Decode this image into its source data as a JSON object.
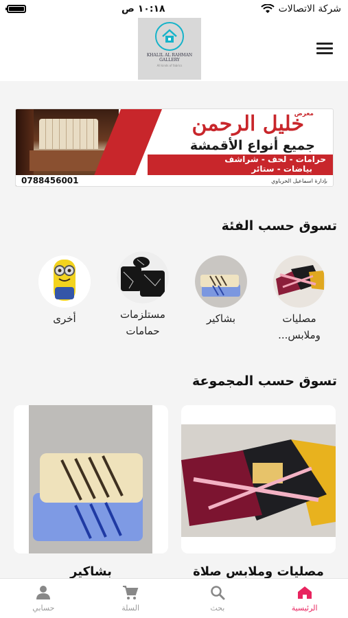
{
  "status": {
    "carrier": "شركة الاتصالات",
    "time": "١٠:١٨ ص"
  },
  "header": {
    "logo_name": "KHALIL AL RAHMAN GALLERY",
    "logo_tag": "All kinds of fabrics"
  },
  "banner": {
    "brand_small": "معرض",
    "brand": "خليل الرحمن",
    "subtitle": "جميع أنواع الأقمشة",
    "line1": "حرامات - لحف - شراشف",
    "line2": "بياضات - ستائر",
    "phone": "0788456001",
    "manager": "بإدارة اسماعيل الحرباوي"
  },
  "sections": {
    "categories_title": "تسوق حسب الفئة",
    "collections_title": "تسوق حسب المجموعة"
  },
  "categories": [
    {
      "label": "مصليات وملابس..."
    },
    {
      "label": "بشاكير"
    },
    {
      "label": "مستلزمات حمامات"
    },
    {
      "label": "أخرى"
    }
  ],
  "collections": [
    {
      "label": "مصليات وملابس صلاة"
    },
    {
      "label": "بشاكير"
    }
  ],
  "nav": [
    {
      "label": "الرئيسية",
      "icon": "home-icon",
      "active": true
    },
    {
      "label": "بحث",
      "icon": "search-icon",
      "active": false
    },
    {
      "label": "السلة",
      "icon": "cart-icon",
      "active": false
    },
    {
      "label": "حسابي",
      "icon": "user-icon",
      "active": false
    }
  ],
  "colors": {
    "accent": "#e8245f",
    "brand_red": "#c8262b",
    "logo_teal": "#16b3c9"
  }
}
